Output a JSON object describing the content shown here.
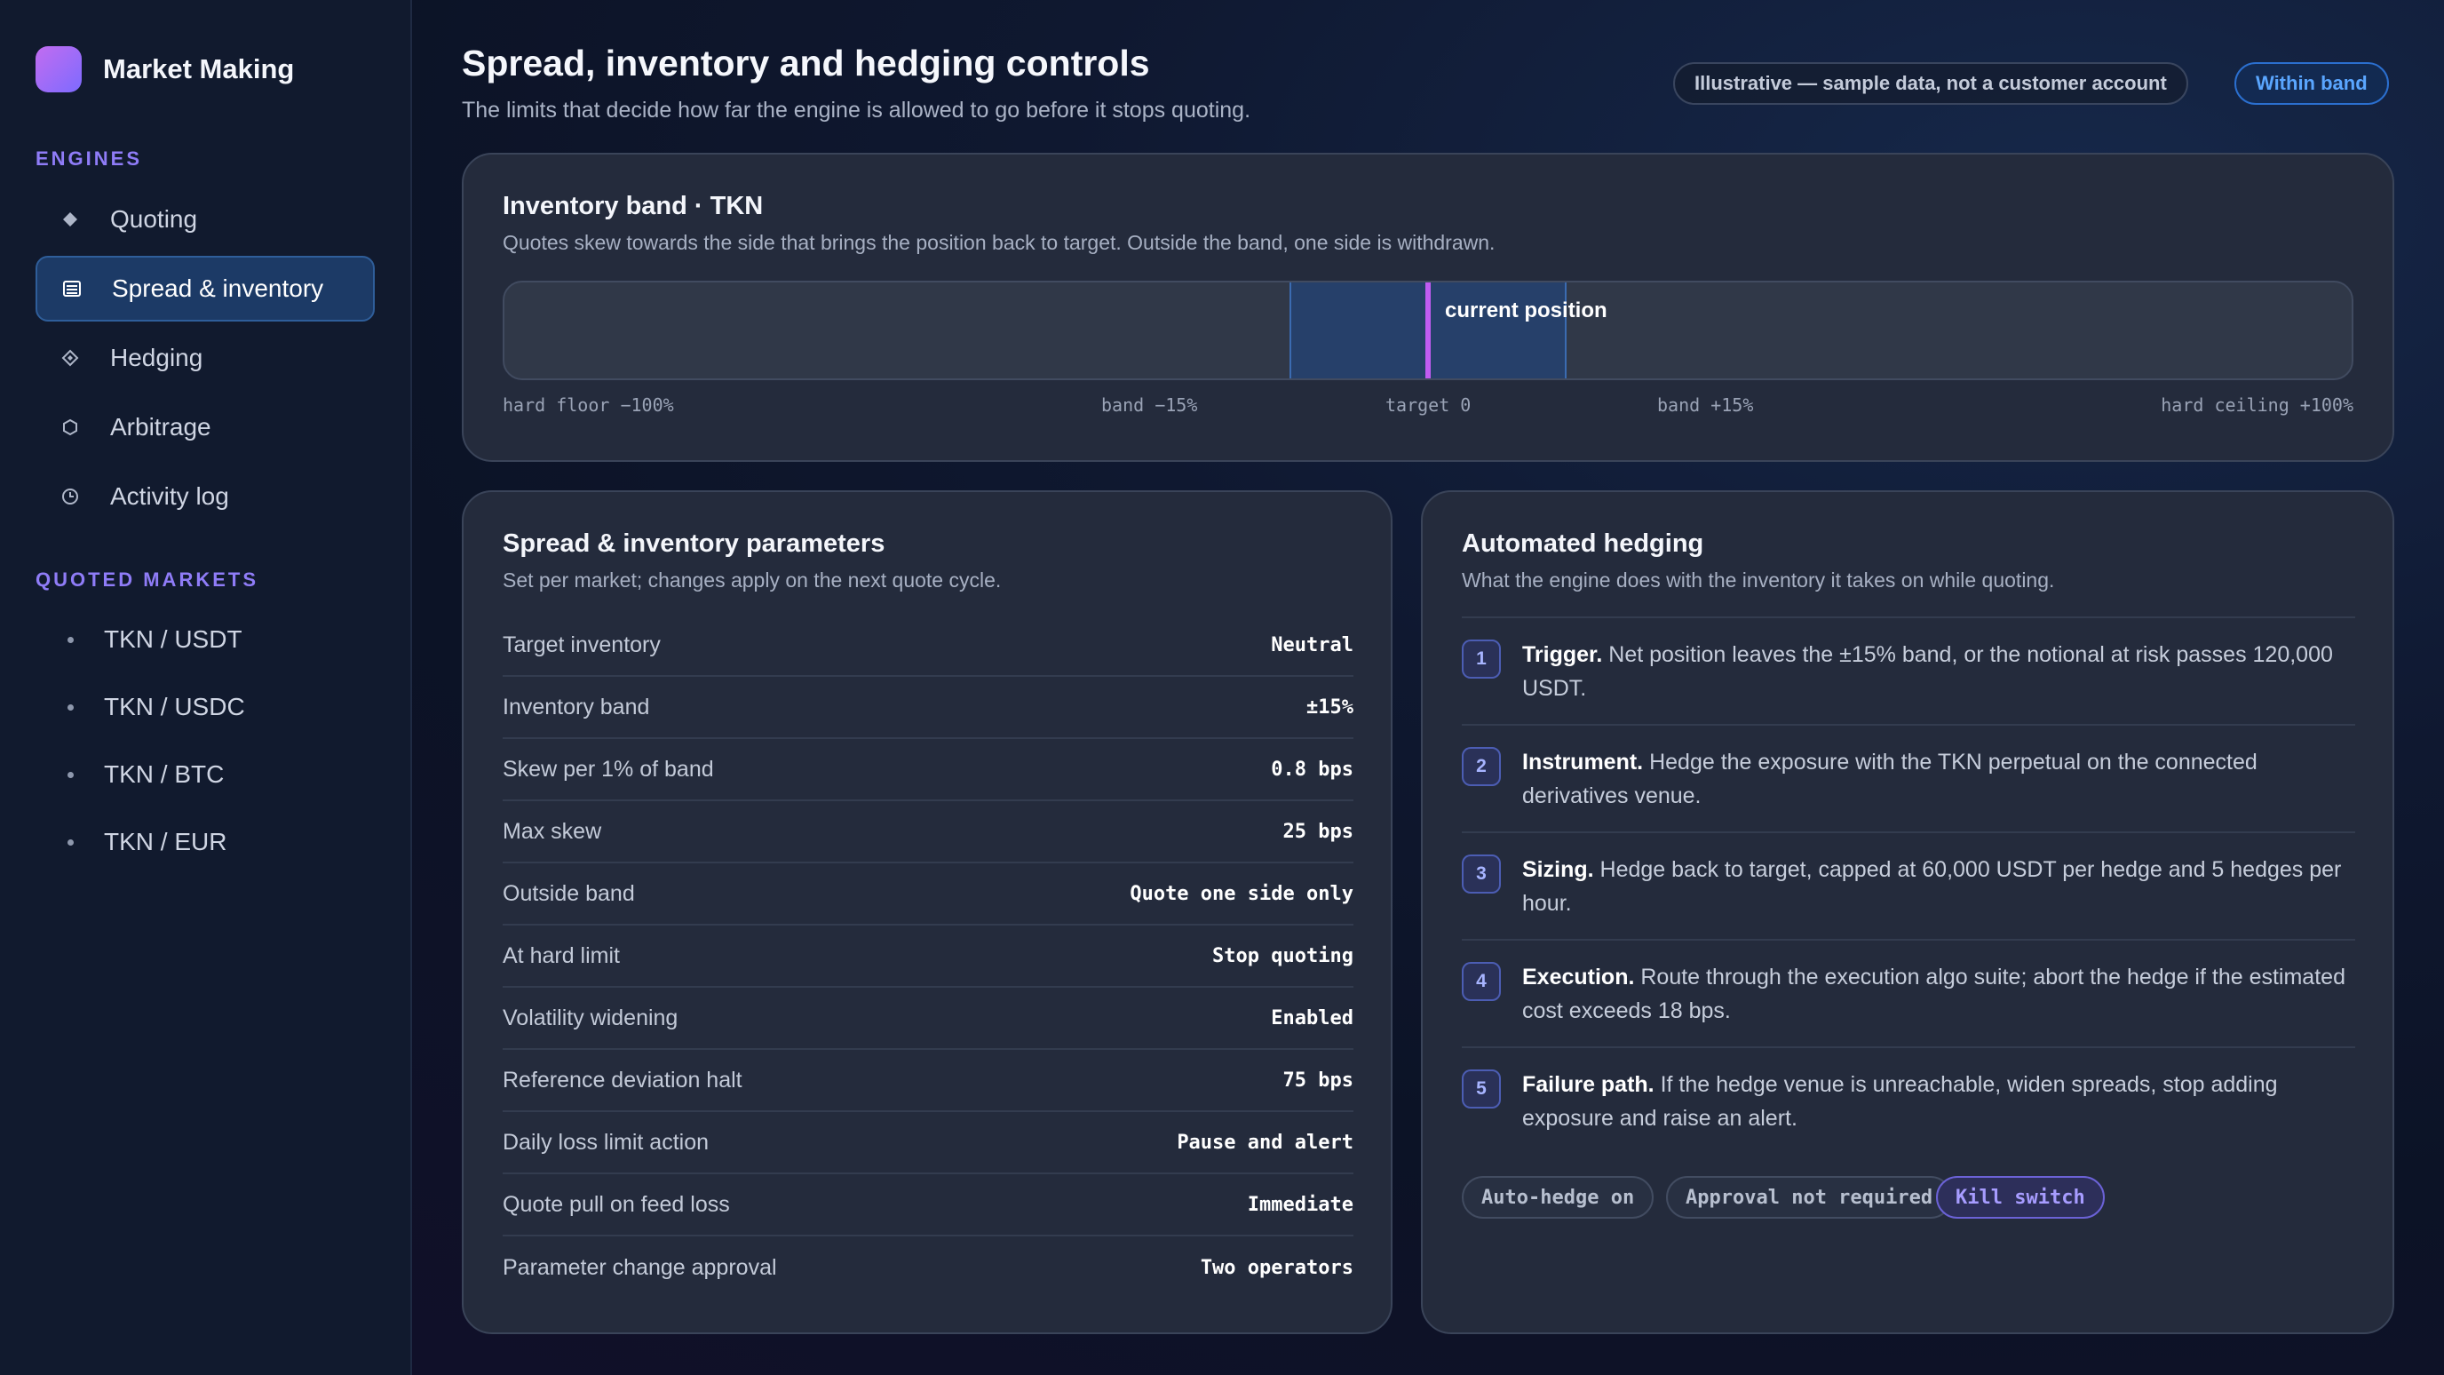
{
  "brand": {
    "name": "Market Making"
  },
  "sidebar": {
    "engines_label": "ENGINES",
    "engines": [
      {
        "label": "Quoting",
        "icon": "diamond-icon"
      },
      {
        "label": "Spread & inventory",
        "icon": "list-icon",
        "active": true
      },
      {
        "label": "Hedging",
        "icon": "diamond-outline-icon"
      },
      {
        "label": "Arbitrage",
        "icon": "hexagon-icon"
      },
      {
        "label": "Activity log",
        "icon": "clock-icon"
      }
    ],
    "markets_label": "QUOTED MARKETS",
    "markets": [
      {
        "label": "TKN / USDT"
      },
      {
        "label": "TKN / USDC"
      },
      {
        "label": "TKN / BTC"
      },
      {
        "label": "TKN / EUR"
      }
    ]
  },
  "header": {
    "title": "Spread, inventory and hedging controls",
    "subtitle": "The limits that decide how far the engine is allowed to go before it stops quoting.",
    "illustrative_pill": "Illustrative — sample data, not a customer account",
    "status_pill": "Within band"
  },
  "band": {
    "title": "Inventory band · TKN",
    "subtitle": "Quotes skew towards the side that brings the position back to target. Outside the band, one side is withdrawn.",
    "position_label": "current position",
    "band_low_pct": -15,
    "band_high_pct": 15,
    "current_position_pct": 0,
    "ticks": {
      "floor": "hard floor −100%",
      "band_low": "band −15%",
      "target": "target 0",
      "band_high": "band +15%",
      "ceiling": "hard ceiling +100%"
    }
  },
  "params": {
    "title": "Spread & inventory parameters",
    "subtitle": "Set per market; changes apply on the next quote cycle.",
    "rows": [
      {
        "label": "Target inventory",
        "value": "Neutral"
      },
      {
        "label": "Inventory band",
        "value": "±15%"
      },
      {
        "label": "Skew per 1% of band",
        "value": "0.8 bps"
      },
      {
        "label": "Max skew",
        "value": "25 bps"
      },
      {
        "label": "Outside band",
        "value": "Quote one side only"
      },
      {
        "label": "At hard limit",
        "value": "Stop quoting"
      },
      {
        "label": "Volatility widening",
        "value": "Enabled"
      },
      {
        "label": "Reference deviation halt",
        "value": "75 bps"
      },
      {
        "label": "Daily loss limit action",
        "value": "Pause and alert"
      },
      {
        "label": "Quote pull on feed loss",
        "value": "Immediate"
      },
      {
        "label": "Parameter change approval",
        "value": "Two operators"
      }
    ]
  },
  "hedging": {
    "title": "Automated hedging",
    "subtitle": "What the engine does with the inventory it takes on while quoting.",
    "steps": [
      {
        "num": "1",
        "head": "Trigger.",
        "body": "Net position leaves the ±15% band, or the notional at risk passes 120,000 USDT."
      },
      {
        "num": "2",
        "head": "Instrument.",
        "body": "Hedge the exposure with the TKN perpetual on the connected derivatives venue."
      },
      {
        "num": "3",
        "head": "Sizing.",
        "body": "Hedge back to target, capped at 60,000 USDT per hedge and 5 hedges per hour."
      },
      {
        "num": "4",
        "head": "Execution.",
        "body": "Route through the execution algo suite; abort the hedge if the estimated cost exceeds 18 bps."
      },
      {
        "num": "5",
        "head": "Failure path.",
        "body": "If the hedge venue is unreachable, widen spreads, stop adding exposure and raise an alert."
      }
    ],
    "tags": {
      "auto_hedge": "Auto-hedge on",
      "approval": "Approval not required",
      "kill_switch": "Kill switch"
    }
  }
}
